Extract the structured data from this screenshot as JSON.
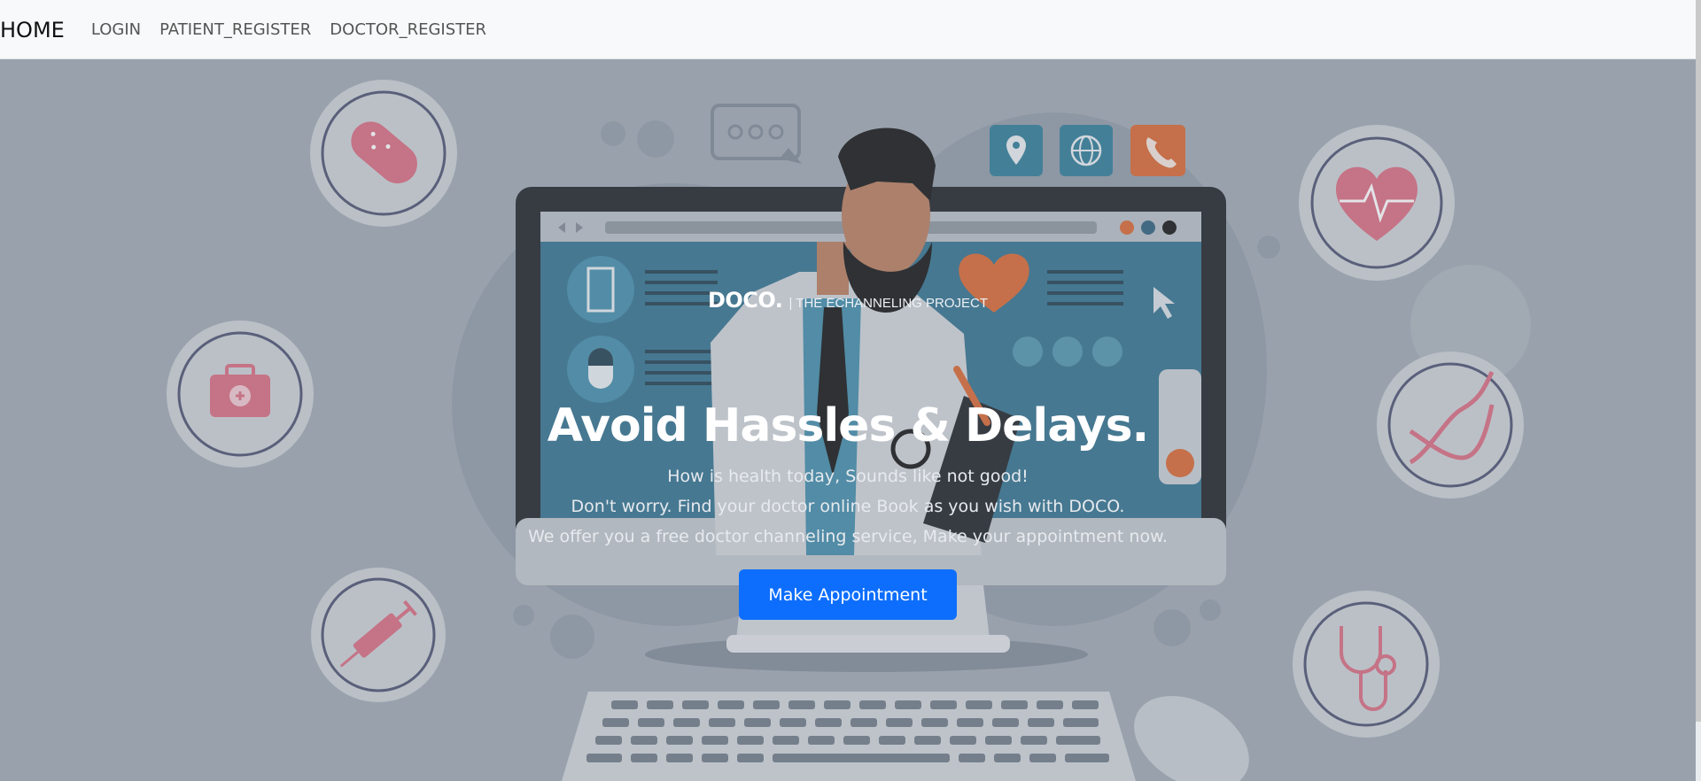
{
  "nav": {
    "brand": "HOME",
    "links": [
      "LOGIN",
      "PATIENT_REGISTER",
      "DOCTOR_REGISTER"
    ]
  },
  "hero": {
    "brand": "DOCO.",
    "tagline": "| THE ECHANNELING PROJECT",
    "headline": "Avoid Hassles & Delays.",
    "lines": [
      "How is health today, Sounds like not good!",
      "Don't worry. Find your doctor online Book as you wish with DOCO.",
      "We offer you a free doctor channeling service, Make your appointment now."
    ],
    "cta_label": "Make Appointment"
  },
  "icons": {
    "left": [
      "pill-icon",
      "first-aid-kit-icon",
      "syringe-icon"
    ],
    "right": [
      "heart-rate-icon",
      "dna-icon",
      "stethoscope-icon"
    ],
    "top": [
      "chat-bubble-icon",
      "location-pin-icon",
      "globe-icon",
      "phone-icon"
    ]
  },
  "colors": {
    "accent": "#0d6efd",
    "hero_bg": "#9ea7b1",
    "icon_pink": "#d9687e",
    "icon_orange": "#e06a2c",
    "icon_teal": "#2b7a96"
  }
}
